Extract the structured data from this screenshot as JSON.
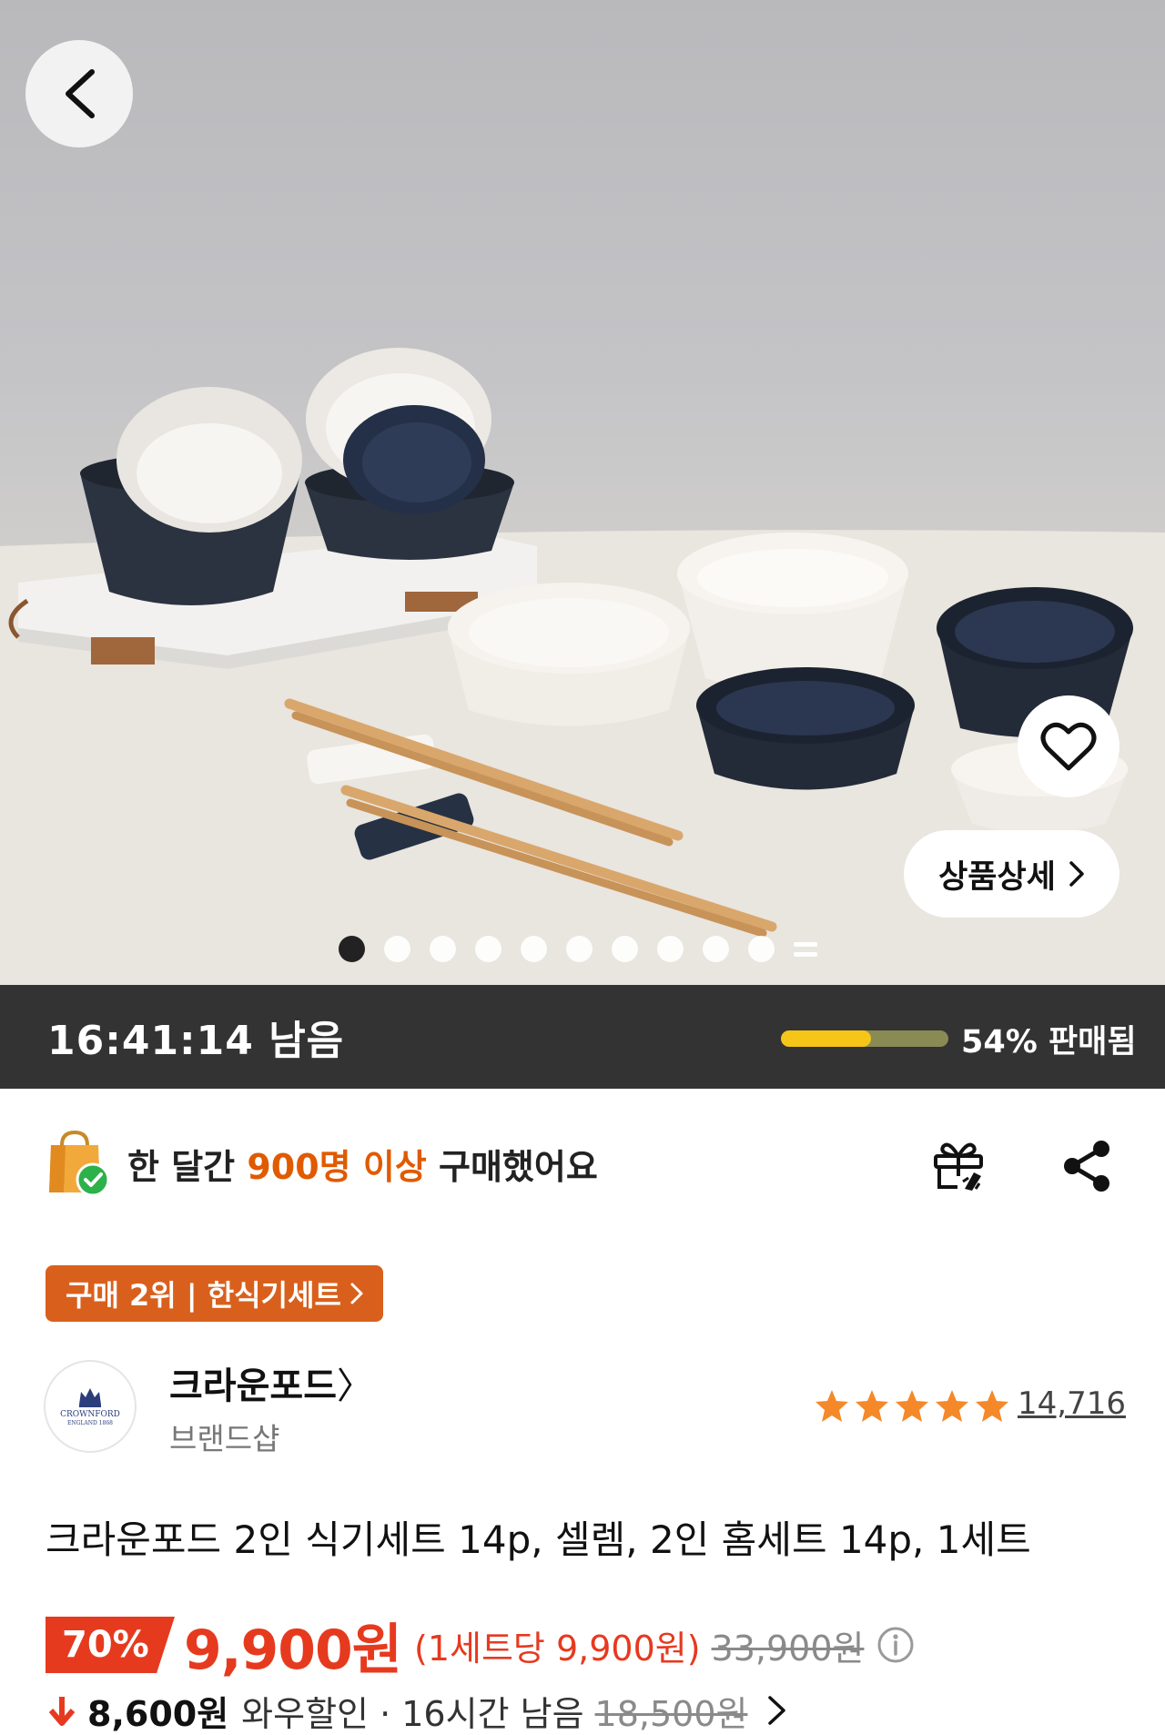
{
  "nav": {
    "back_icon": "chevron-left-icon",
    "wishlist_icon": "heart-outline-icon"
  },
  "hero": {
    "detail_button_label": "상품상세",
    "detail_chevron": "chevron-right-icon",
    "slide_count": 10,
    "active_slide": 1
  },
  "deal": {
    "timer": "16:41:14 남음",
    "sold_percent": 54,
    "sold_text": "54% 판매됨",
    "progress_color": "#f5c518"
  },
  "purchase_info": {
    "prefix": "한 달간 ",
    "highlight": "900명 이상",
    "suffix": " 구매했어요",
    "highlight_color": "#e05a00",
    "gift_icon": "gift-icon",
    "share_icon": "share-icon"
  },
  "rank": {
    "label": "구매 2위 | 한식기세트",
    "chevron": "chevron-right-icon"
  },
  "brand": {
    "name": "크라운포드",
    "name_chevron": "〉",
    "subtitle": "브랜드샵",
    "logo_text_1": "CROWNFORD",
    "logo_text_2": "ENGLAND 1868"
  },
  "rating": {
    "stars": 5,
    "review_count": "14,716",
    "star_color": "#f5892a"
  },
  "product": {
    "title": "크라운포드 2인 식기세트 14p, 셀렘, 2인 홈세트 14p, 1세트"
  },
  "price": {
    "discount": "70%",
    "sale": "9,900원",
    "unit": "(1세트당 9,900원)",
    "original": "33,900원",
    "accent_color": "#e63a1f"
  },
  "wow": {
    "price": "8,600원",
    "label": "와우할인 · 16시간 남음",
    "original": "18,500원"
  }
}
